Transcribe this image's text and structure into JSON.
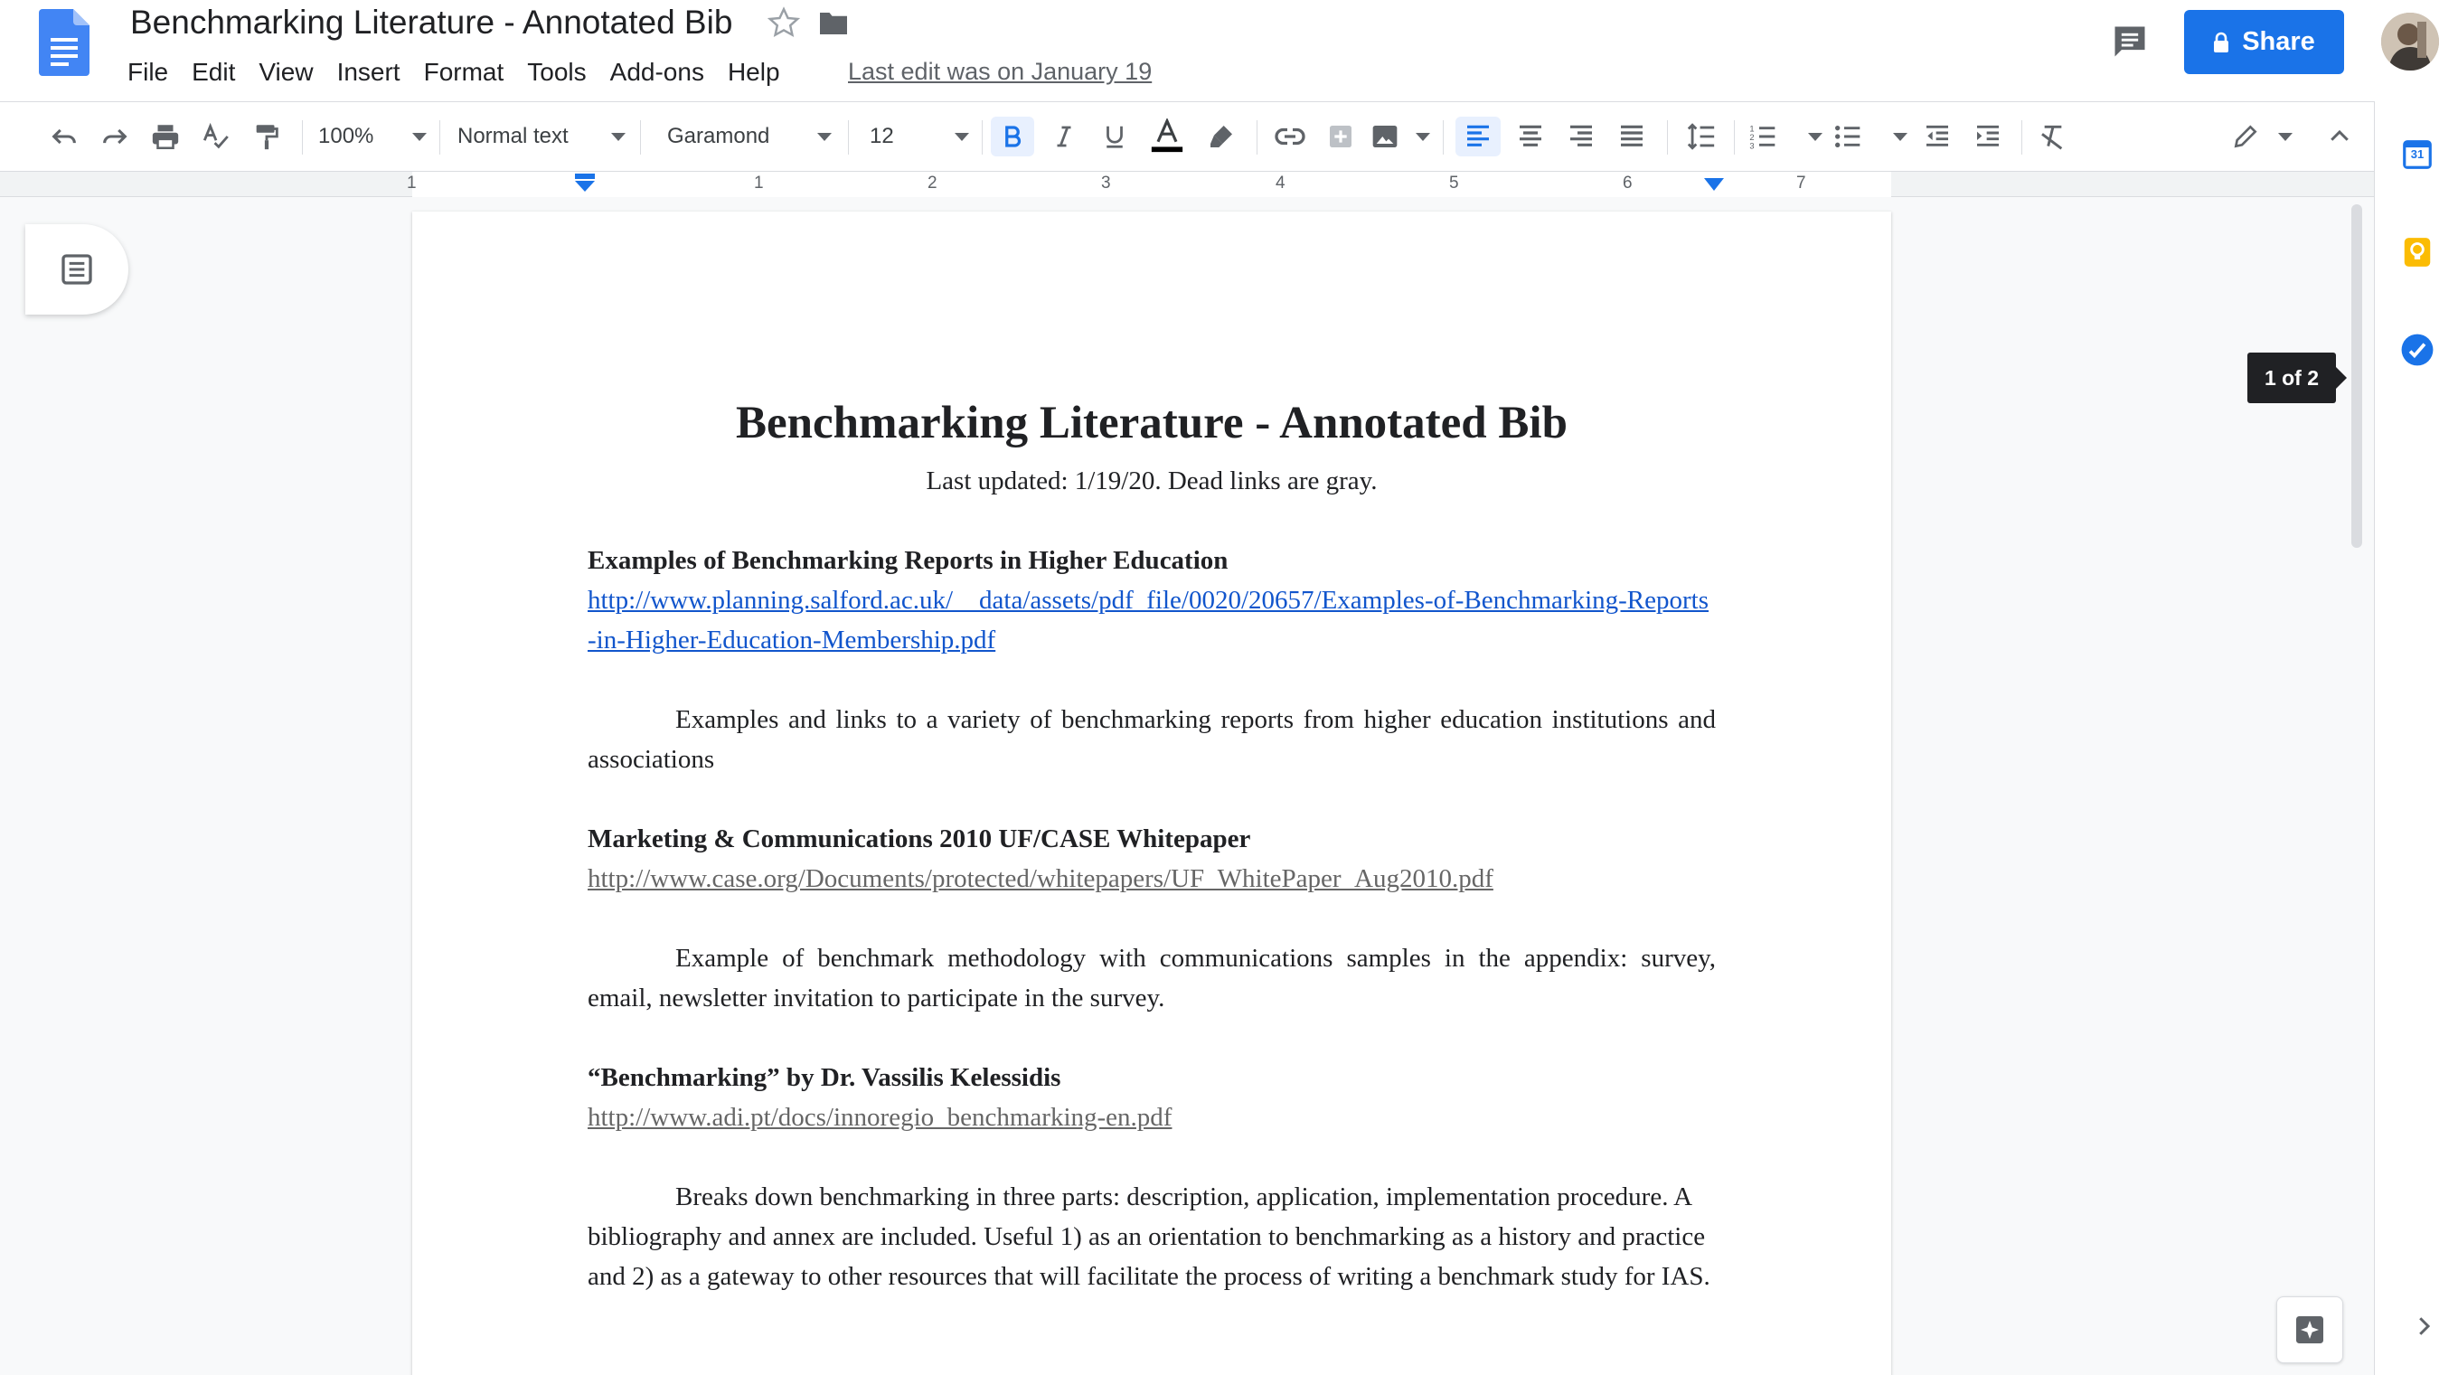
{
  "document": {
    "title": "Benchmarking Literature - Annotated Bib",
    "last_edit": "Last edit was on January 19"
  },
  "menu": [
    "File",
    "Edit",
    "View",
    "Insert",
    "Format",
    "Tools",
    "Add-ons",
    "Help"
  ],
  "header": {
    "share_label": "Share"
  },
  "toolbar": {
    "zoom": "100%",
    "style": "Normal text",
    "font": "Garamond",
    "font_size": "12"
  },
  "ruler": {
    "numbers": [
      "1",
      "1",
      "2",
      "3",
      "4",
      "5",
      "6",
      "7"
    ]
  },
  "page_indicator": "1 of 2",
  "side_panel": {
    "calendar_day": "31"
  },
  "content": {
    "heading": "Benchmarking Literature - Annotated Bib",
    "subtitle": "Last updated: 1/19/20. Dead links are gray.",
    "entries": [
      {
        "title": "Examples of Benchmarking Reports in Higher Education",
        "url": "http://www.planning.salford.ac.uk/__data/assets/pdf_file/0020/20657/Examples-of-Benchmarking-Reports-in-Higher-Education-Membership.pdf",
        "url_dead": false,
        "annotation": "Examples and links to a variety of benchmarking reports from higher education institutions and associations"
      },
      {
        "title": "Marketing & Communications 2010 UF/CASE Whitepaper",
        "url": "http://www.case.org/Documents/protected/whitepapers/UF_WhitePaper_Aug2010.pdf",
        "url_dead": true,
        "annotation": "Example of benchmark methodology with communications samples in the appendix: survey, email, newsletter invitation to participate in the survey."
      },
      {
        "title": "“Benchmarking” by  Dr. Vassilis Kelessidis",
        "url": "http://www.adi.pt/docs/innoregio_benchmarking-en.pdf",
        "url_dead": true,
        "annotation": "Breaks down benchmarking in three parts: description, application, implementation procedure. A bibliography and annex are included. Useful 1) as an orientation to benchmarking as a history and practice and 2) as a gateway to other resources that will facilitate the process of writing a benchmark study for IAS."
      }
    ]
  },
  "colors": {
    "accent": "#1a73e8",
    "link": "#1155cc",
    "dead_link": "#666666",
    "docs_blue": "#4285f4"
  }
}
